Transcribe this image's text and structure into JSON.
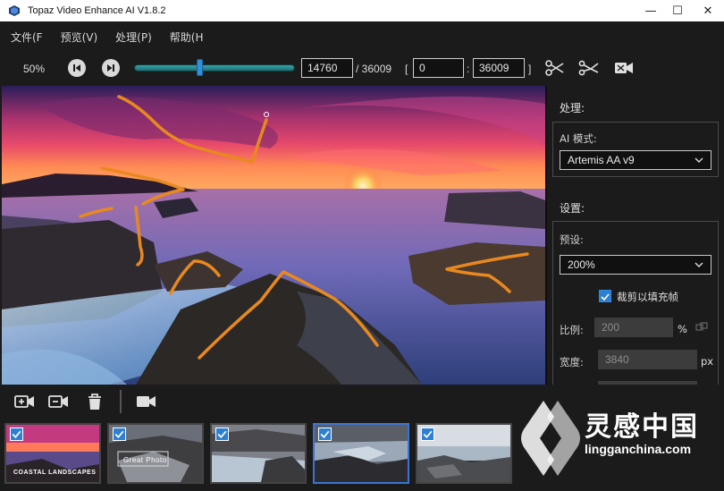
{
  "window": {
    "title": "Topaz Video Enhance AI V1.8.2",
    "controls": {
      "minimize": "—",
      "maximize": "☐",
      "close": "✕"
    }
  },
  "menu": [
    "文件(F",
    "预览(V)",
    "处理(P)",
    "帮助(H"
  ],
  "toolbar": {
    "zoom": "50%",
    "slider_position": 0.41,
    "current_frame": "14760",
    "total_frames": "/ 36009",
    "open_bracket": "[",
    "range_start": "0",
    "range_sep": ":",
    "range_end": "36009",
    "close_bracket": "]"
  },
  "panel": {
    "process_header": "处理:",
    "ai_mode_label": "AI 模式:",
    "ai_mode_value": "Artemis AA v9",
    "settings_header": "设置:",
    "preset_label": "预设:",
    "preset_value": "200%",
    "crop_fill_label": "裁剪以填充帧",
    "crop_fill_checked": true,
    "scale_label": "比例:",
    "scale_value": "200",
    "scale_unit": "%",
    "width_label": "宽度:",
    "width_value": "3840",
    "width_unit": "px"
  },
  "thumbnails": [
    {
      "caption": "COASTAL LANDSCAPES",
      "checked": true,
      "selected": false
    },
    {
      "caption": "Great Photo",
      "checked": true,
      "selected": false
    },
    {
      "caption": "",
      "checked": true,
      "selected": false
    },
    {
      "caption": "",
      "checked": true,
      "selected": true
    },
    {
      "caption": "",
      "checked": true,
      "selected": false
    }
  ],
  "watermark": {
    "name": "灵感中国",
    "url": "lingganchina.com"
  },
  "colors": {
    "accent": "#2d7fd3",
    "slider": "#3aa3a8",
    "annotation": "#e8891f",
    "background": "#1b1b1b"
  }
}
